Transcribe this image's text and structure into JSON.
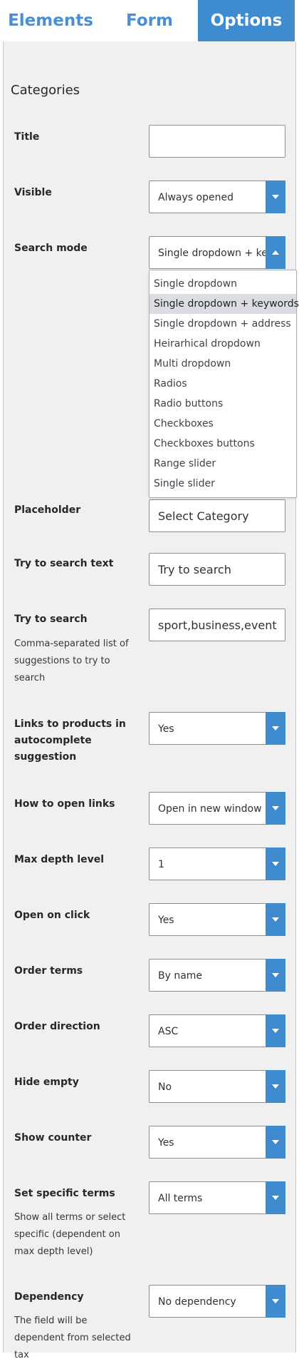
{
  "tabs": [
    {
      "label": "Elements",
      "active": false
    },
    {
      "label": "Form",
      "active": false
    },
    {
      "label": "Options",
      "active": true
    }
  ],
  "section_title": "Categories",
  "fields": {
    "title": {
      "label": "Title",
      "value": ""
    },
    "visible": {
      "label": "Visible",
      "value": "Always opened"
    },
    "search_mode": {
      "label": "Search mode",
      "value": "Single dropdown + keywords"
    },
    "placeholder": {
      "label": "Placeholder",
      "value": "Select Category"
    },
    "try_search_text": {
      "label": "Try to search text",
      "value": "Try to search"
    },
    "try_search": {
      "label": "Try to search",
      "description": "Comma-separated list of suggestions to try to search",
      "value": "sport,business,event"
    },
    "links_to_products": {
      "label": "Links to products in autocomplete suggestion",
      "value": "Yes"
    },
    "how_to_open_links": {
      "label": "How to open links",
      "value": "Open in new window"
    },
    "max_depth_level": {
      "label": "Max depth level",
      "value": "1"
    },
    "open_on_click": {
      "label": "Open on click",
      "value": "Yes"
    },
    "order_terms": {
      "label": "Order terms",
      "value": "By name"
    },
    "order_direction": {
      "label": "Order direction",
      "value": "ASC"
    },
    "hide_empty": {
      "label": "Hide empty",
      "value": "No"
    },
    "show_counter": {
      "label": "Show counter",
      "value": "Yes"
    },
    "set_specific_terms": {
      "label": "Set specific terms",
      "description": "Show all terms or select specific (dependent on max depth level)",
      "value": "All terms"
    },
    "dependency": {
      "label": "Dependency",
      "description": "The field will be dependent from selected tax",
      "value": "No dependency"
    }
  },
  "search_mode_options": [
    "Single dropdown",
    "Single dropdown + keywords",
    "Single dropdown + address",
    "Heirarhical dropdown",
    "Multi dropdown",
    "Radios",
    "Radio buttons",
    "Checkboxes",
    "Checkboxes buttons",
    "Range slider",
    "Single slider"
  ],
  "highlighted_option": "Single dropdown + keywords",
  "colors": {
    "accent": "#3f8bd0",
    "panel_bg": "#f0f0f0",
    "highlight": "#dcdde3"
  }
}
